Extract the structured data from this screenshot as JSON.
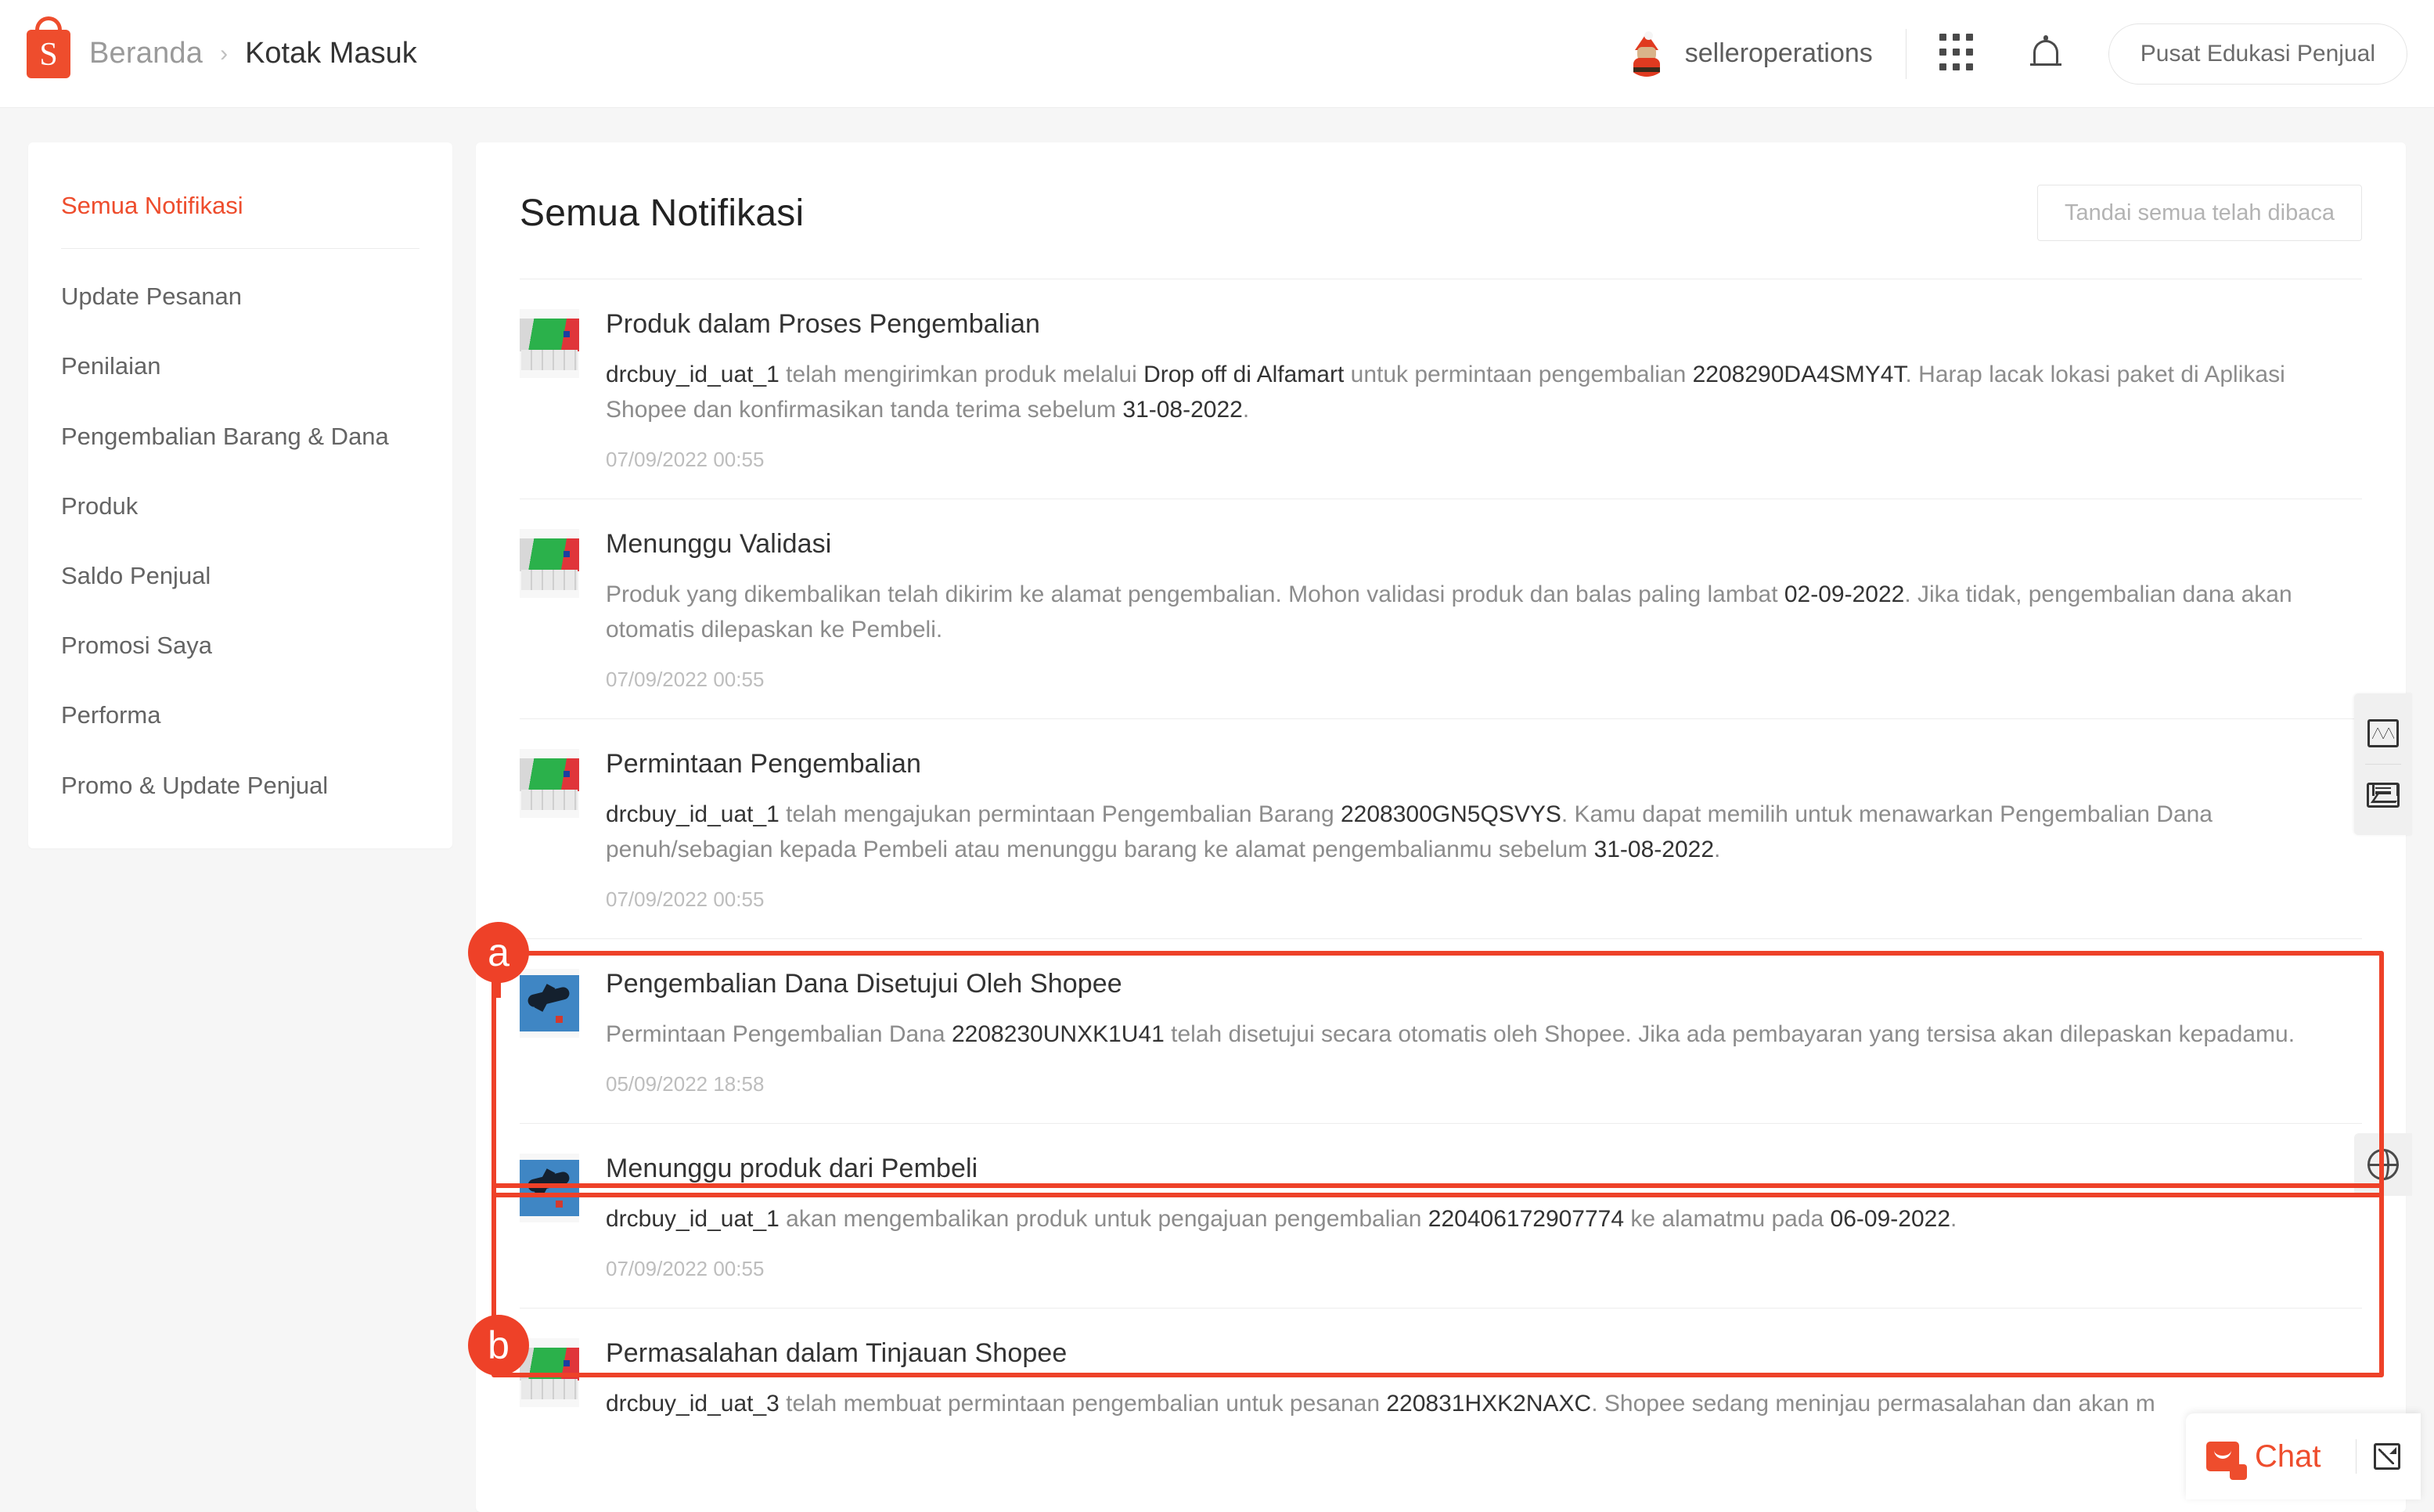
{
  "header": {
    "logo_icon": "shopee-bag-icon",
    "breadcrumb_home": "Beranda",
    "breadcrumb_sep": "›",
    "breadcrumb_current": "Kotak Masuk",
    "username": "selleroperations",
    "avatar_icon": "santa-avatar-icon",
    "apps_icon": "grid-apps-icon",
    "bell_icon": "bell-icon",
    "education_button": "Pusat Edukasi Penjual"
  },
  "sidebar": {
    "items": [
      {
        "label": "Semua Notifikasi",
        "active": true
      },
      {
        "label": "Update Pesanan",
        "active": false
      },
      {
        "label": "Penilaian",
        "active": false
      },
      {
        "label": "Pengembalian Barang & Dana",
        "active": false
      },
      {
        "label": "Produk",
        "active": false
      },
      {
        "label": "Saldo Penjual",
        "active": false
      },
      {
        "label": "Promosi Saya",
        "active": false
      },
      {
        "label": "Performa",
        "active": false
      },
      {
        "label": "Promo & Update Penjual",
        "active": false
      }
    ]
  },
  "main": {
    "title": "Semua Notifikasi",
    "mark_all_read": "Tandai semua telah dibaca",
    "notifications": [
      {
        "thumb": "package-product-image",
        "title": "Produk dalam Proses Pengembalian",
        "desc_parts": [
          {
            "t": "drcbuy_id_uat_1",
            "strong": true
          },
          {
            "t": " telah mengirimkan produk melalui ",
            "strong": false
          },
          {
            "t": "Drop off di Alfamart",
            "strong": true
          },
          {
            "t": " untuk permintaan pengembalian ",
            "strong": false
          },
          {
            "t": "2208290DA4SMY4T",
            "strong": true
          },
          {
            "t": ". Harap lacak lokasi paket di Aplikasi Shopee dan konfirmasikan tanda terima sebelum ",
            "strong": false
          },
          {
            "t": "31-08-2022",
            "strong": true
          },
          {
            "t": ".",
            "strong": false
          }
        ],
        "time": "07/09/2022 00:55"
      },
      {
        "thumb": "package-product-image",
        "title": "Menunggu Validasi",
        "desc_parts": [
          {
            "t": "Produk yang dikembalikan telah dikirim ke alamat pengembalian. Mohon validasi produk dan balas paling lambat ",
            "strong": false
          },
          {
            "t": "02-09-2022",
            "strong": true
          },
          {
            "t": ". Jika tidak, pengembalian dana akan otomatis dilepaskan ke Pembeli.",
            "strong": false
          }
        ],
        "time": "07/09/2022 00:55"
      },
      {
        "thumb": "package-product-image",
        "title": "Permintaan Pengembalian",
        "desc_parts": [
          {
            "t": "drcbuy_id_uat_1",
            "strong": true
          },
          {
            "t": " telah mengajukan permintaan Pengembalian Barang ",
            "strong": false
          },
          {
            "t": "2208300GN5QSVYS",
            "strong": true
          },
          {
            "t": ". Kamu dapat memilih untuk menawarkan Pengembalian Dana penuh/sebagian kepada Pembeli atau menunggu barang ke alamat pengembalianmu sebelum ",
            "strong": false
          },
          {
            "t": "31-08-2022",
            "strong": true
          },
          {
            "t": ".",
            "strong": false
          }
        ],
        "time": "07/09/2022 00:55"
      },
      {
        "thumb": "airplane-image",
        "title": "Pengembalian Dana Disetujui Oleh Shopee",
        "desc_parts": [
          {
            "t": "Permintaan Pengembalian Dana ",
            "strong": false
          },
          {
            "t": "2208230UNXK1U41",
            "strong": true
          },
          {
            "t": " telah disetujui secara otomatis oleh Shopee. Jika ada pembayaran yang tersisa akan dilepaskan kepadamu.",
            "strong": false
          }
        ],
        "time": "05/09/2022 18:58"
      },
      {
        "thumb": "airplane-image",
        "title": "Menunggu produk dari Pembeli",
        "desc_parts": [
          {
            "t": "drcbuy_id_uat_1",
            "strong": true
          },
          {
            "t": " akan mengembalikan produk untuk pengajuan pengembalian ",
            "strong": false
          },
          {
            "t": "220406172907774",
            "strong": true
          },
          {
            "t": " ke alamatmu pada ",
            "strong": false
          },
          {
            "t": "06-09-2022",
            "strong": true
          },
          {
            "t": ".",
            "strong": false
          }
        ],
        "time": "07/09/2022 00:55"
      },
      {
        "thumb": "package-product-image",
        "title": "Permasalahan dalam Tinjauan Shopee",
        "desc_parts": [
          {
            "t": "drcbuy_id_uat_3",
            "strong": true
          },
          {
            "t": " telah membuat permintaan pengembalian untuk pesanan ",
            "strong": false
          },
          {
            "t": "220831HXK2NAXC",
            "strong": true
          },
          {
            "t": ". Shopee sedang meninjau permasalahan dan akan m",
            "strong": false
          }
        ],
        "time": ""
      }
    ]
  },
  "dock": {
    "analytics_icon": "pulse-monitor-icon",
    "inbox_icon": "envelope-icon",
    "globe_icon": "globe-icon"
  },
  "chat": {
    "icon": "chat-bubble-icon",
    "label": "Chat",
    "expand_icon": "expand-arrow-icon"
  },
  "annotations": {
    "accent_color": "#ee4128",
    "markers": [
      {
        "label": "a"
      },
      {
        "label": "b"
      }
    ]
  },
  "colors": {
    "brand_orange": "#ee4d2d",
    "annotation_red": "#ee4128",
    "page_bg": "#f6f6f6",
    "panel_bg": "#ffffff",
    "text_primary": "#333333",
    "text_muted": "#8c8c8c"
  }
}
